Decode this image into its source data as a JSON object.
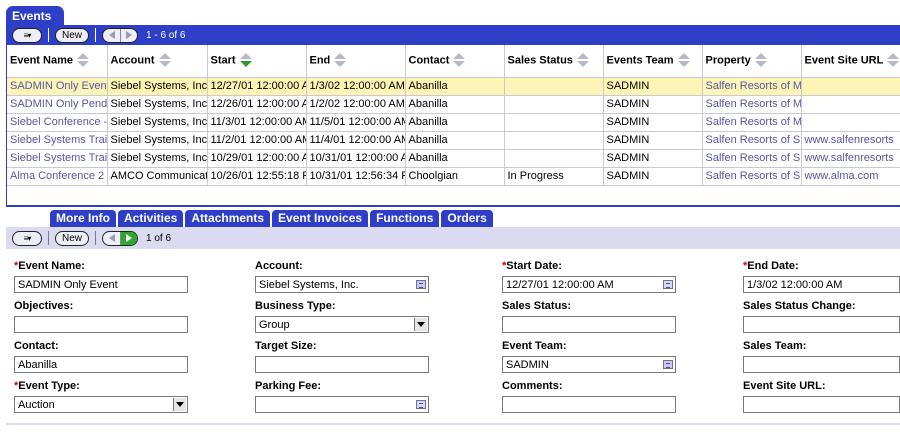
{
  "list": {
    "title": "Events",
    "toolbar": {
      "menu_glyph": "≡▾",
      "new_label": "New",
      "record_count": "1 - 6 of 6"
    },
    "columns": [
      "Event Name",
      "Account",
      "Start",
      "End",
      "Contact",
      "Sales Status",
      "Events Team",
      "Property",
      "Event Site URL"
    ],
    "sorted_column": "Start",
    "rows": [
      [
        "SADMIN Only Event",
        "Siebel Systems, Inc",
        "12/27/01 12:00:00 A",
        "1/3/02 12:00:00 AM",
        "Abanilla",
        "",
        "SADMIN",
        "Salfen Resorts of M",
        ""
      ],
      [
        "SADMIN Only Pendin",
        "Siebel Systems, Inc",
        "12/26/01 12:00:00 A",
        "1/2/02 12:00:00 AM",
        "Abanilla",
        "",
        "SADMIN",
        "Salfen Resorts of M",
        ""
      ],
      [
        "Siebel Conference -",
        "Siebel Systems, Inc",
        "11/3/01 12:00:00 AM",
        "11/5/01 12:00:00 AM",
        "Abanilla",
        "",
        "SADMIN",
        "Salfen Resorts of M",
        ""
      ],
      [
        "Siebel Systems Trai",
        "Siebel Systems, Inc",
        "11/2/01 12:00:00 AM",
        "11/4/01 12:00:00 AM",
        "Abanilla",
        "",
        "SADMIN",
        "Salfen Resorts of S",
        "www.salfenresorts"
      ],
      [
        "Siebel Systems Trai",
        "Siebel Systems, Inc",
        "10/29/01 12:00:00 A",
        "10/31/01 12:00:00 A",
        "Abanilla",
        "",
        "SADMIN",
        "Salfen Resorts of S",
        "www.salfenresorts"
      ],
      [
        "Alma Conference 2",
        "AMCO Communicatio",
        "10/26/01 12:55:18 P",
        "10/31/01 12:56:34 P",
        "Choolgian",
        "In Progress",
        "SADMIN",
        "Salfen Resorts of S",
        "www.alma.com"
      ]
    ],
    "selected_row": 0
  },
  "tabs": [
    "More Info",
    "Activities",
    "Attachments",
    "Event Invoices",
    "Functions",
    "Orders"
  ],
  "form": {
    "toolbar": {
      "menu_glyph": "≡▾",
      "new_label": "New",
      "record_count": "1 of 6"
    },
    "fields": {
      "event_name": {
        "label": "Event Name:",
        "value": "SADMIN Only Event"
      },
      "objectives": {
        "label": "Objectives:",
        "value": ""
      },
      "contact": {
        "label": "Contact:",
        "value": "Abanilla"
      },
      "event_type": {
        "label": "Event Type:",
        "value": "Auction"
      },
      "account": {
        "label": "Account:",
        "value": "Siebel Systems, Inc."
      },
      "business_type": {
        "label": "Business Type:",
        "value": "Group"
      },
      "target_size": {
        "label": "Target Size:",
        "value": ""
      },
      "parking_fee": {
        "label": "Parking Fee:",
        "value": ""
      },
      "start_date": {
        "label": "Start Date:",
        "value": "12/27/01 12:00:00 AM"
      },
      "sales_status": {
        "label": "Sales Status:",
        "value": ""
      },
      "event_team": {
        "label": "Event Team:",
        "value": "SADMIN"
      },
      "comments": {
        "label": "Comments:",
        "value": ""
      },
      "end_date": {
        "label": "End Date:",
        "value": "1/3/02 12:00:00 AM"
      },
      "sales_status_change": {
        "label": "Sales Status Change:",
        "value": ""
      },
      "sales_team": {
        "label": "Sales Team:",
        "value": ""
      },
      "event_site_url": {
        "label": "Event Site URL:",
        "value": ""
      }
    },
    "required_marker": "*"
  },
  "colors": {
    "brand_blue": "#2f3ec7",
    "selected_row": "#fdf4b5",
    "link": "#5656a8",
    "required": "#d00000",
    "form_bar": "#dadaf0"
  },
  "icons": [
    "menu-dropdown-icon",
    "prev-record-icon",
    "next-record-icon",
    "sort-ascending-icon",
    "sort-descending-icon",
    "pick-applet-icon",
    "calendar-icon",
    "dropdown-arrow-icon"
  ]
}
